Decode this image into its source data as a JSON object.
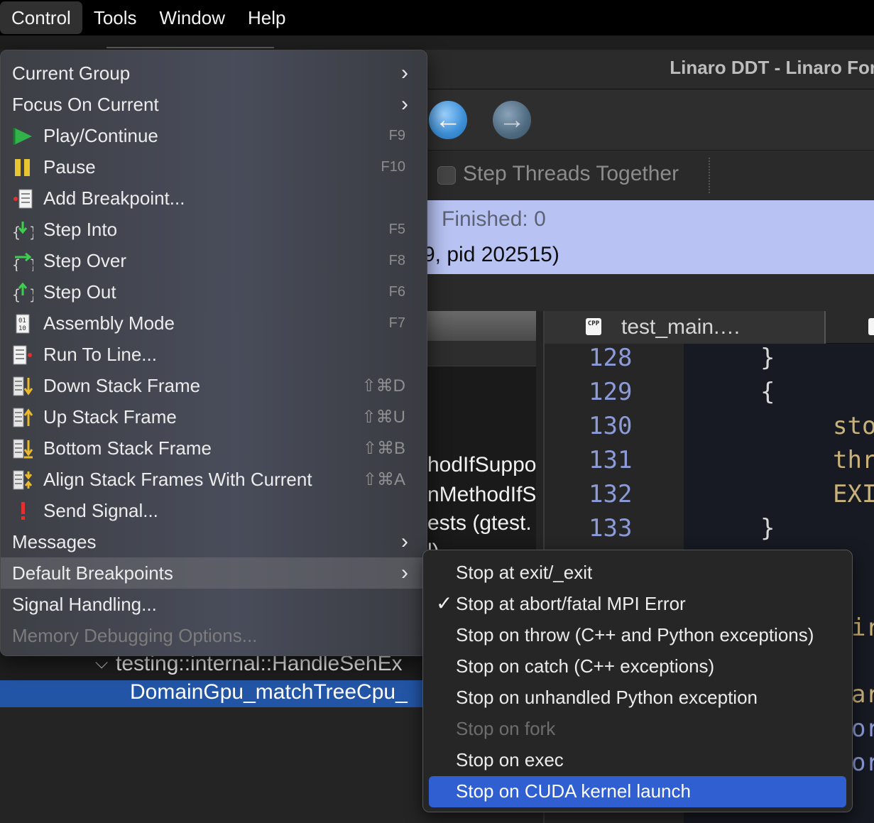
{
  "menubar": {
    "items": [
      "Control",
      "Tools",
      "Window",
      "Help"
    ]
  },
  "window": {
    "title": "Linaro DDT - Linaro For"
  },
  "toolbar": {
    "step_threads_label": "Step Threads Together"
  },
  "status": {
    "finished": "Finished: 0",
    "pid_line": "9, pid 202515)"
  },
  "left_panel": {
    "lines": [
      "hodIfSuppo",
      "nMethodIfS",
      "ests (gtest.",
      "l)"
    ]
  },
  "editor": {
    "tab_label": "test_main.…",
    "tab_icon": "CPP",
    "line_numbers": [
      "128",
      "129",
      "130",
      "131",
      "132",
      "133"
    ],
    "code_lines": [
      "}",
      "{",
      "sto",
      "thr",
      "EXI",
      "}"
    ],
    "right_fragments": [
      "ir",
      "ar",
      "or",
      "or"
    ]
  },
  "tree": {
    "row1_label": "testing::internal::HandleSehEx",
    "row2_label": "DomainGpu_matchTreeCpu_"
  },
  "control_menu": {
    "items": [
      {
        "label": "Current Group",
        "submenu": true
      },
      {
        "label": "Focus On Current",
        "submenu": true
      },
      {
        "label": "Play/Continue",
        "shortcut": "F9",
        "icon": "play-icon"
      },
      {
        "label": "Pause",
        "shortcut": "F10",
        "icon": "pause-icon"
      },
      {
        "label": "Add Breakpoint...",
        "shortcut": "",
        "icon": "breakpoint-icon"
      },
      {
        "label": "Step Into",
        "shortcut": "F5",
        "icon": "step-into-icon"
      },
      {
        "label": "Step Over",
        "shortcut": "F8",
        "icon": "step-over-icon"
      },
      {
        "label": "Step Out",
        "shortcut": "F6",
        "icon": "step-out-icon"
      },
      {
        "label": "Assembly Mode",
        "shortcut": "F7",
        "icon": "assembly-icon"
      },
      {
        "label": "Run To Line...",
        "shortcut": "",
        "icon": "run-to-line-icon"
      },
      {
        "label": "Down Stack Frame",
        "shortcut": "⇧⌘D",
        "icon": "down-stack-icon"
      },
      {
        "label": "Up Stack Frame",
        "shortcut": "⇧⌘U",
        "icon": "up-stack-icon"
      },
      {
        "label": "Bottom Stack Frame",
        "shortcut": "⇧⌘B",
        "icon": "bottom-stack-icon"
      },
      {
        "label": "Align Stack Frames With Current",
        "shortcut": "⇧⌘A",
        "icon": "align-stack-icon"
      },
      {
        "label": "Send Signal...",
        "shortcut": "",
        "icon": "signal-icon"
      },
      {
        "label": "Messages",
        "submenu": true
      },
      {
        "label": "Default Breakpoints",
        "submenu": true,
        "highlighted": true
      },
      {
        "label": "Signal Handling...",
        "submenu": false
      },
      {
        "label": "Memory Debugging Options...",
        "disabled": true
      }
    ]
  },
  "breakpoints_submenu": {
    "items": [
      {
        "label": "Stop at exit/_exit",
        "checked": false
      },
      {
        "label": "Stop at abort/fatal MPI Error",
        "checked": true
      },
      {
        "label": "Stop on throw (C++ and Python exceptions)",
        "checked": false
      },
      {
        "label": "Stop on catch (C++ exceptions)",
        "checked": false
      },
      {
        "label": "Stop on unhandled Python exception",
        "checked": false
      },
      {
        "label": "Stop on fork",
        "checked": false,
        "disabled": true
      },
      {
        "label": "Stop on exec",
        "checked": false
      },
      {
        "label": "Stop on CUDA kernel launch",
        "checked": false,
        "selected": true
      }
    ],
    "check_glyph": "✓"
  },
  "colors": {
    "selection_blue": "#2f5fd0",
    "status_background": "#b8c3f3",
    "tree_selection": "#2355a6",
    "line_number": "#8c9bd8"
  }
}
